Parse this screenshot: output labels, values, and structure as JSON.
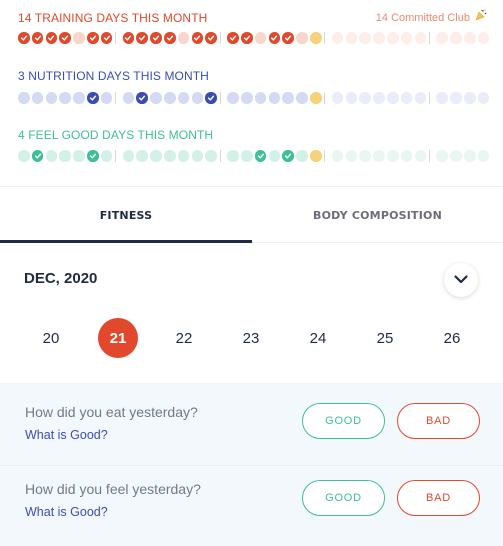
{
  "colors": {
    "training": "#e2482c",
    "training_light": "#f9d5cc",
    "training_faint": "#fdeeea",
    "nutrition": "#3a4db5",
    "nutrition_light": "#d4daf3",
    "nutrition_faint": "#eaedf9",
    "feel": "#3dbf98",
    "feel_light": "#d3f1e6",
    "feel_faint": "#e8f7f1",
    "today": "#f6d27a"
  },
  "streaks": [
    {
      "title": "14 TRAINING DAYS THIS MONTH",
      "color_key": "training",
      "club": "14 Committed Club",
      "club_icon": "party-popper-icon",
      "days": [
        "done",
        "done",
        "done",
        "done",
        "future",
        "done",
        "done",
        "done",
        "done",
        "done",
        "done",
        "future",
        "done",
        "done",
        "done",
        "done",
        "future",
        "done",
        "done",
        "future",
        "today",
        "faint",
        "faint",
        "faint",
        "faint",
        "faint",
        "faint",
        "faint",
        "faint",
        "faint",
        "faint",
        "faint"
      ]
    },
    {
      "title": "3 NUTRITION DAYS THIS MONTH",
      "color_key": "nutrition",
      "club": "",
      "days": [
        "light",
        "light",
        "light",
        "light",
        "light",
        "done",
        "light",
        "light",
        "done",
        "light",
        "light",
        "light",
        "light",
        "done",
        "light",
        "light",
        "light",
        "light",
        "light",
        "light",
        "today",
        "faint",
        "faint",
        "faint",
        "faint",
        "faint",
        "faint",
        "faint",
        "faint",
        "faint",
        "faint",
        "faint"
      ]
    },
    {
      "title": "4 FEEL GOOD DAYS THIS MONTH",
      "color_key": "feel",
      "club": "",
      "days": [
        "light",
        "done",
        "light",
        "light",
        "light",
        "done",
        "light",
        "light",
        "light",
        "light",
        "light",
        "light",
        "light",
        "light",
        "light",
        "light",
        "done",
        "light",
        "done",
        "light",
        "today",
        "faint",
        "faint",
        "faint",
        "faint",
        "faint",
        "faint",
        "faint",
        "faint",
        "faint",
        "faint",
        "faint"
      ]
    }
  ],
  "tabs": [
    {
      "label": "FITNESS",
      "active": true
    },
    {
      "label": "BODY COMPOSITION",
      "active": false
    }
  ],
  "calendar": {
    "month": "DEC, 2020",
    "toggle_icon": "chevron-down-icon",
    "days": [
      "20",
      "21",
      "22",
      "23",
      "24",
      "25",
      "26"
    ],
    "selected": "21"
  },
  "questions": [
    {
      "text": "How did you eat yesterday?",
      "link": "What is Good?",
      "good": "GOOD",
      "bad": "BAD"
    },
    {
      "text": "How did you feel yesterday?",
      "link": "What is Good?",
      "good": "GOOD",
      "bad": "BAD"
    }
  ]
}
